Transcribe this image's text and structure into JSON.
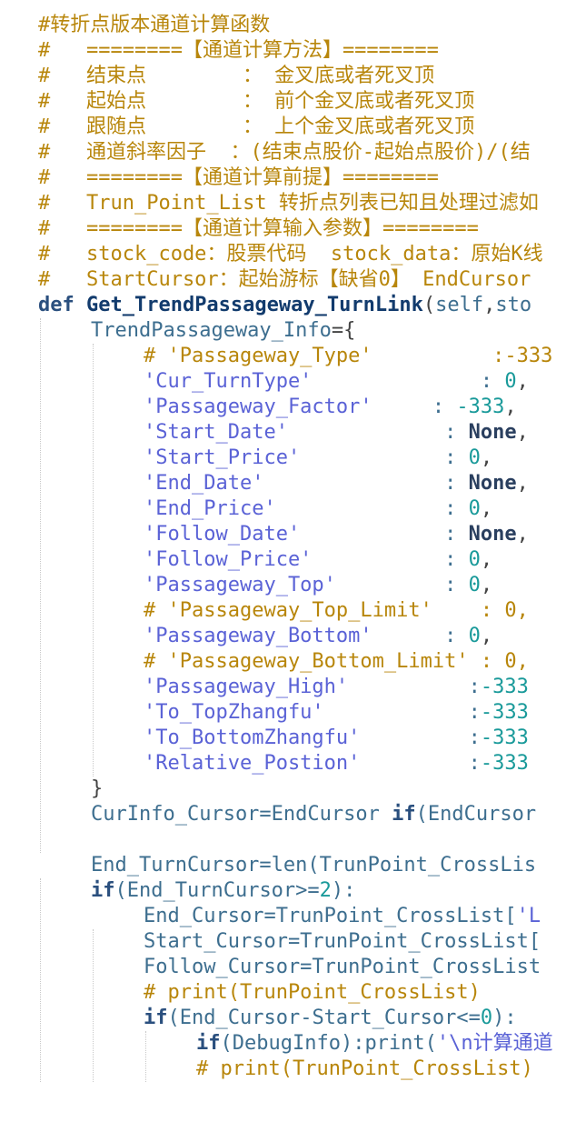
{
  "editor": {
    "language": "python",
    "colors": {
      "background": "#ffffff",
      "comment": "#b8860b",
      "keyword": "#2a4f7e",
      "string": "#5a62d6",
      "number": "#1a9a9a",
      "identifier": "#3d6e8f"
    },
    "lines": [
      {
        "indent": 0,
        "tokens": [
          {
            "t": "comment",
            "v": "#转折点版本通道计算函数"
          }
        ]
      },
      {
        "indent": 0,
        "tokens": [
          {
            "t": "comment",
            "v": "#   ========【通道计算方法】========"
          }
        ]
      },
      {
        "indent": 0,
        "tokens": [
          {
            "t": "comment",
            "v": "#   结束点        ： 金叉底或者死叉顶"
          }
        ]
      },
      {
        "indent": 0,
        "tokens": [
          {
            "t": "comment",
            "v": "#   起始点        ： 前个金叉底或者死叉顶"
          }
        ]
      },
      {
        "indent": 0,
        "tokens": [
          {
            "t": "comment",
            "v": "#   跟随点        ： 上个金叉底或者死叉顶"
          }
        ]
      },
      {
        "indent": 0,
        "tokens": [
          {
            "t": "comment",
            "v": "#   通道斜率因子  ：(结束点股价-起始点股价)/(结"
          }
        ]
      },
      {
        "indent": 0,
        "tokens": [
          {
            "t": "comment",
            "v": "#   ========【通道计算前提】========"
          }
        ]
      },
      {
        "indent": 0,
        "tokens": [
          {
            "t": "comment",
            "v": "#   Trun_Point_List 转折点列表已知且处理过滤如"
          }
        ]
      },
      {
        "indent": 0,
        "tokens": [
          {
            "t": "comment",
            "v": "#   ========【通道计算输入参数】========"
          }
        ]
      },
      {
        "indent": 0,
        "tokens": [
          {
            "t": "comment",
            "v": "#   stock_code：股票代码  stock_data：原始K线"
          }
        ]
      },
      {
        "indent": 0,
        "tokens": [
          {
            "t": "comment",
            "v": "#   StartCursor：起始游标【缺省0】 EndCursor"
          }
        ]
      },
      {
        "indent": 0,
        "tokens": [
          {
            "t": "kw",
            "v": "def "
          },
          {
            "t": "fn",
            "v": "Get_TrendPassageway_TurnLink"
          },
          {
            "t": "op",
            "v": "("
          },
          {
            "t": "ident",
            "v": "self"
          },
          {
            "t": "op",
            "v": ","
          },
          {
            "t": "ident",
            "v": "sto"
          }
        ]
      },
      {
        "indent": 1,
        "tokens": [
          {
            "t": "ident",
            "v": "TrendPassageway_Info"
          },
          {
            "t": "op",
            "v": "={"
          }
        ]
      },
      {
        "indent": 2,
        "tokens": [
          {
            "t": "comment",
            "v": "# 'Passageway_Type'          :-333"
          }
        ]
      },
      {
        "indent": 2,
        "tokens": [
          {
            "t": "str",
            "v": "'Cur_TurnType'"
          },
          {
            "t": "plain",
            "v": "              : "
          },
          {
            "t": "num",
            "v": "0"
          },
          {
            "t": "op",
            "v": ","
          }
        ]
      },
      {
        "indent": 2,
        "tokens": [
          {
            "t": "str",
            "v": "'Passageway_Factor'"
          },
          {
            "t": "plain",
            "v": "     : "
          },
          {
            "t": "num",
            "v": "-333"
          },
          {
            "t": "op",
            "v": ","
          }
        ]
      },
      {
        "indent": 2,
        "tokens": [
          {
            "t": "str",
            "v": "'Start_Date'"
          },
          {
            "t": "plain",
            "v": "             : "
          },
          {
            "t": "none",
            "v": "None"
          },
          {
            "t": "op",
            "v": ","
          }
        ]
      },
      {
        "indent": 2,
        "tokens": [
          {
            "t": "str",
            "v": "'Start_Price'"
          },
          {
            "t": "plain",
            "v": "            : "
          },
          {
            "t": "num",
            "v": "0"
          },
          {
            "t": "op",
            "v": ","
          }
        ]
      },
      {
        "indent": 2,
        "tokens": [
          {
            "t": "str",
            "v": "'End_Date'"
          },
          {
            "t": "plain",
            "v": "               : "
          },
          {
            "t": "none",
            "v": "None"
          },
          {
            "t": "op",
            "v": ","
          }
        ]
      },
      {
        "indent": 2,
        "tokens": [
          {
            "t": "str",
            "v": "'End_Price'"
          },
          {
            "t": "plain",
            "v": "              : "
          },
          {
            "t": "num",
            "v": "0"
          },
          {
            "t": "op",
            "v": ","
          }
        ]
      },
      {
        "indent": 2,
        "tokens": [
          {
            "t": "str",
            "v": "'Follow_Date'"
          },
          {
            "t": "plain",
            "v": "            : "
          },
          {
            "t": "none",
            "v": "None"
          },
          {
            "t": "op",
            "v": ","
          }
        ]
      },
      {
        "indent": 2,
        "tokens": [
          {
            "t": "str",
            "v": "'Follow_Price'"
          },
          {
            "t": "plain",
            "v": "           : "
          },
          {
            "t": "num",
            "v": "0"
          },
          {
            "t": "op",
            "v": ","
          }
        ]
      },
      {
        "indent": 2,
        "tokens": [
          {
            "t": "str",
            "v": "'Passageway_Top'"
          },
          {
            "t": "plain",
            "v": "         : "
          },
          {
            "t": "num",
            "v": "0"
          },
          {
            "t": "op",
            "v": ","
          }
        ]
      },
      {
        "indent": 2,
        "tokens": [
          {
            "t": "comment",
            "v": "# 'Passageway_Top_Limit'    : 0,"
          }
        ]
      },
      {
        "indent": 2,
        "tokens": [
          {
            "t": "str",
            "v": "'Passageway_Bottom'"
          },
          {
            "t": "plain",
            "v": "      : "
          },
          {
            "t": "num",
            "v": "0"
          },
          {
            "t": "op",
            "v": ","
          }
        ]
      },
      {
        "indent": 2,
        "tokens": [
          {
            "t": "comment",
            "v": "# 'Passageway_Bottom_Limit' : 0,"
          }
        ]
      },
      {
        "indent": 2,
        "tokens": [
          {
            "t": "str",
            "v": "'Passageway_High'"
          },
          {
            "t": "plain",
            "v": "          :"
          },
          {
            "t": "num",
            "v": "-333"
          }
        ]
      },
      {
        "indent": 2,
        "tokens": [
          {
            "t": "str",
            "v": "'To_TopZhangfu'"
          },
          {
            "t": "plain",
            "v": "            :"
          },
          {
            "t": "num",
            "v": "-333"
          }
        ]
      },
      {
        "indent": 2,
        "tokens": [
          {
            "t": "str",
            "v": "'To_BottomZhangfu'"
          },
          {
            "t": "plain",
            "v": "         :"
          },
          {
            "t": "num",
            "v": "-333"
          }
        ]
      },
      {
        "indent": 2,
        "tokens": [
          {
            "t": "str",
            "v": "'Relative_Postion'"
          },
          {
            "t": "plain",
            "v": "         :"
          },
          {
            "t": "num",
            "v": "-333"
          }
        ]
      },
      {
        "indent": 1,
        "tokens": [
          {
            "t": "op",
            "v": "}"
          }
        ]
      },
      {
        "indent": 1,
        "tokens": [
          {
            "t": "ident",
            "v": "CurInfo_Cursor=EndCursor "
          },
          {
            "t": "kw",
            "v": "if"
          },
          {
            "t": "ident",
            "v": "(EndCursor"
          }
        ]
      },
      {
        "indent": 0,
        "tokens": []
      },
      {
        "indent": 1,
        "tokens": [
          {
            "t": "ident",
            "v": "End_TurnCursor=len(TrunPoint_CrossLis"
          }
        ]
      },
      {
        "indent": 1,
        "tokens": [
          {
            "t": "kw",
            "v": "if"
          },
          {
            "t": "ident",
            "v": "(End_TurnCursor>="
          },
          {
            "t": "num",
            "v": "2"
          },
          {
            "t": "ident",
            "v": "):"
          }
        ]
      },
      {
        "indent": 2,
        "tokens": [
          {
            "t": "ident",
            "v": "End_Cursor=TrunPoint_CrossList["
          },
          {
            "t": "str",
            "v": "'L"
          }
        ]
      },
      {
        "indent": 2,
        "tokens": [
          {
            "t": "ident",
            "v": "Start_Cursor=TrunPoint_CrossList["
          }
        ]
      },
      {
        "indent": 2,
        "tokens": [
          {
            "t": "ident",
            "v": "Follow_Cursor=TrunPoint_CrossList"
          }
        ]
      },
      {
        "indent": 2,
        "tokens": [
          {
            "t": "comment",
            "v": "# print(TrunPoint_CrossList)"
          }
        ]
      },
      {
        "indent": 2,
        "tokens": [
          {
            "t": "kw",
            "v": "if"
          },
          {
            "t": "ident",
            "v": "(End_Cursor-Start_Cursor<="
          },
          {
            "t": "num",
            "v": "0"
          },
          {
            "t": "ident",
            "v": "):"
          }
        ]
      },
      {
        "indent": 3,
        "tokens": [
          {
            "t": "kw",
            "v": "if"
          },
          {
            "t": "ident",
            "v": "(DebugInfo):print("
          },
          {
            "t": "str",
            "v": "'\\n计算通道"
          }
        ]
      },
      {
        "indent": 3,
        "tokens": [
          {
            "t": "comment",
            "v": "# print(TrunPoint_CrossList)"
          }
        ]
      }
    ]
  }
}
